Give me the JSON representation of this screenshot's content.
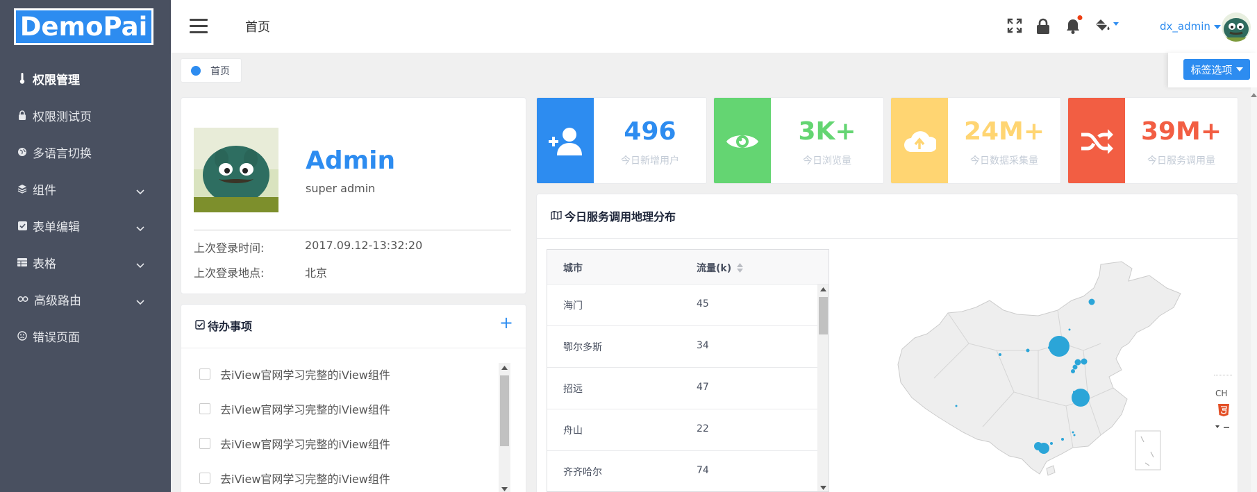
{
  "logo": {
    "text": "DemoPai"
  },
  "sidebar": {
    "items": [
      {
        "label": "权限管理",
        "icon": "thermometer-icon"
      },
      {
        "label": "权限测试页",
        "icon": "lock-icon"
      },
      {
        "label": "多语言切换",
        "icon": "globe-icon"
      },
      {
        "label": "组件",
        "icon": "layers-icon"
      },
      {
        "label": "表单编辑",
        "icon": "checkbox-icon"
      },
      {
        "label": "表格",
        "icon": "table-icon"
      },
      {
        "label": "高级路由",
        "icon": "link-icon"
      },
      {
        "label": "错误页面",
        "icon": "sad-face-icon"
      }
    ]
  },
  "header": {
    "title": "首页",
    "username": "dx_admin"
  },
  "tags": {
    "home": "首页",
    "options": "标签选项"
  },
  "profile": {
    "name": "Admin",
    "role": "super admin",
    "last_login_time_label": "上次登录时间:",
    "last_login_time": "2017.09.12-13:32:20",
    "last_login_place_label": "上次登录地点:",
    "last_login_place": "北京"
  },
  "todo": {
    "title": "待办事项",
    "items": [
      "去iView官网学习完整的iView组件",
      "去iView官网学习完整的iView组件",
      "去iView官网学习完整的iView组件",
      "去iView官网学习完整的iView组件"
    ]
  },
  "stats": [
    {
      "value": "496",
      "label": "今日新增用户",
      "color": "#2d8cf0"
    },
    {
      "value": "3K+",
      "label": "今日浏览量",
      "color": "#64d572"
    },
    {
      "value": "24M+",
      "label": "今日数据采集量",
      "color": "#ffd572"
    },
    {
      "value": "39M+",
      "label": "今日服务调用量",
      "color": "#f25e43"
    }
  ],
  "geo": {
    "title": "今日服务调用地理分布",
    "col_city": "城市",
    "col_flow": "流量(k)",
    "rows": [
      {
        "city": "海门",
        "flow": "45"
      },
      {
        "city": "鄂尔多斯",
        "flow": "34"
      },
      {
        "city": "招远",
        "flow": "47"
      },
      {
        "city": "舟山",
        "flow": "22"
      },
      {
        "city": "齐齐哈尔",
        "flow": "74"
      }
    ]
  },
  "map_tools": {
    "lang": "CH"
  }
}
